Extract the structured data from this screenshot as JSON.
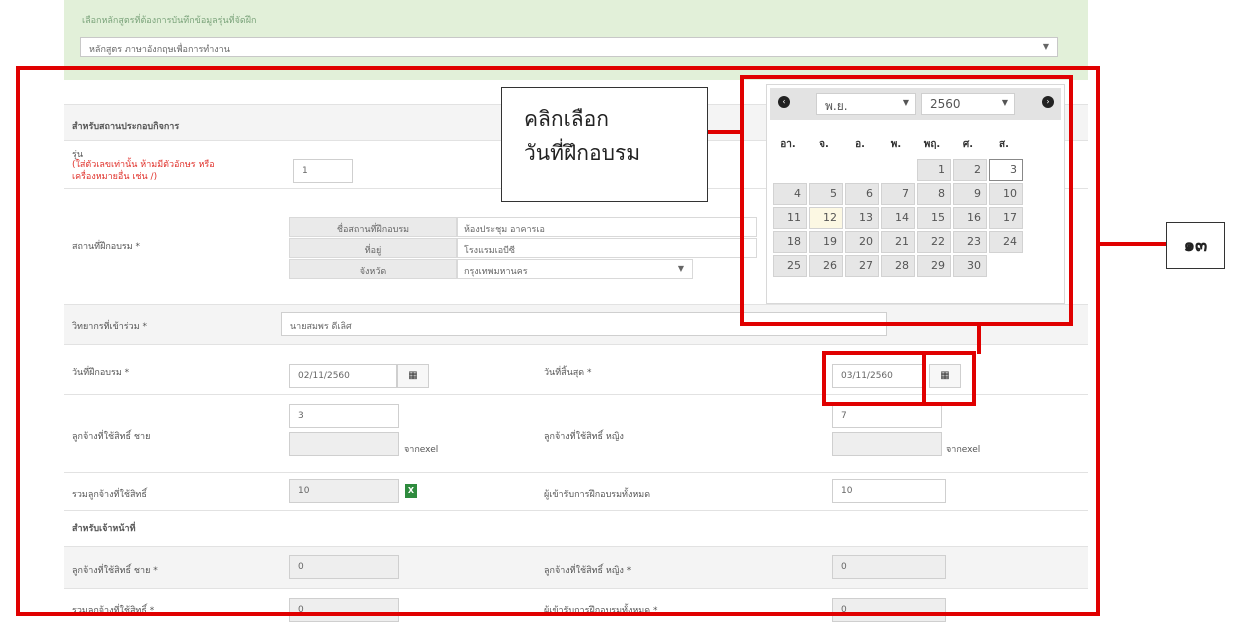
{
  "course": {
    "label": "เลือกหลักสูตรที่ต้องการบันทึกข้อมูลรุ่นที่จัดฝึก",
    "selected": "หลักสูตร ภาษาอังกฤษเพื่อการทำงาน",
    "arrow": "▼"
  },
  "form": {
    "section_company": "สำหรับสถานประกอบกิจการ",
    "batch_label": "รุ่น",
    "batch_hint": "(ใส่ตัวเลขเท่านั้น ห้ามมีตัวอักษร หรือเครื่องหมายอื่น เช่น /)",
    "batch_value": "1",
    "venue_label": "สถานที่ฝึกอบรม *",
    "venue_name_label": "ชื่อสถานที่ฝึกอบรม",
    "venue_name_value": "ห้องประชุม อาคารเอ",
    "venue_address_label": "ที่อยู่",
    "venue_address_value": "โรงแรมเอบีซี",
    "venue_province_label": "จังหวัด",
    "venue_province_value": "กรุงเทพมหานคร",
    "speaker_label": "วิทยากรที่เข้าร่วม *",
    "speaker_value": "นายสมพร ดีเลิศ",
    "start_date_label": "วันที่ฝึกอบรม *",
    "start_date_value": "02/11/2560",
    "end_date_label": "วันที่สิ้นสุด *",
    "end_date_value": "03/11/2560",
    "male_label": "ลูกจ้างที่ใช้สิทธิ์ ชาย",
    "male_value": "3",
    "female_label": "ลูกจ้างที่ใช้สิทธิ์ หญิง",
    "female_value": "7",
    "from_excel": "จากexel",
    "total_label": "รวมลูกจ้างที่ใช้สิทธิ์",
    "total_value": "10",
    "participants_label": "ผู้เข้ารับการฝึกอบรมทั้งหมด",
    "participants_value": "10",
    "section_staff": "สำหรับเจ้าหน้าที่",
    "staff_male_label": "ลูกจ้างที่ใช้สิทธิ์ ชาย *",
    "staff_male_value": "0",
    "staff_female_label": "ลูกจ้างที่ใช้สิทธิ์ หญิง *",
    "staff_female_value": "0",
    "staff_total_label": "รวมลูกจ้างที่ใช้สิทธิ์ *",
    "staff_total_value": "0",
    "staff_participants_label": "ผู้เข้ารับการฝึกอบรมทั้งหมด *",
    "staff_participants_value": "0",
    "calendar_icon": "▦",
    "excel_icon": "X"
  },
  "calendar": {
    "month": "พ.ย.",
    "year": "2560",
    "prev_icon": "‹",
    "next_icon": "›",
    "weekdays": [
      "อา.",
      "จ.",
      "อ.",
      "พ.",
      "พฤ.",
      "ศ.",
      "ส."
    ],
    "days": [
      "1",
      "2",
      "3",
      "4",
      "5",
      "6",
      "7",
      "8",
      "9",
      "10",
      "11",
      "12",
      "13",
      "14",
      "15",
      "16",
      "17",
      "18",
      "19",
      "20",
      "21",
      "22",
      "23",
      "24",
      "25",
      "26",
      "27",
      "28",
      "29",
      "30"
    ]
  },
  "annotation": {
    "callout_line1": "คลิกเลือก",
    "callout_line2": "วันที่ฝึกอบรม",
    "step_number": "๑๓",
    "accent_color": "#e00000"
  }
}
